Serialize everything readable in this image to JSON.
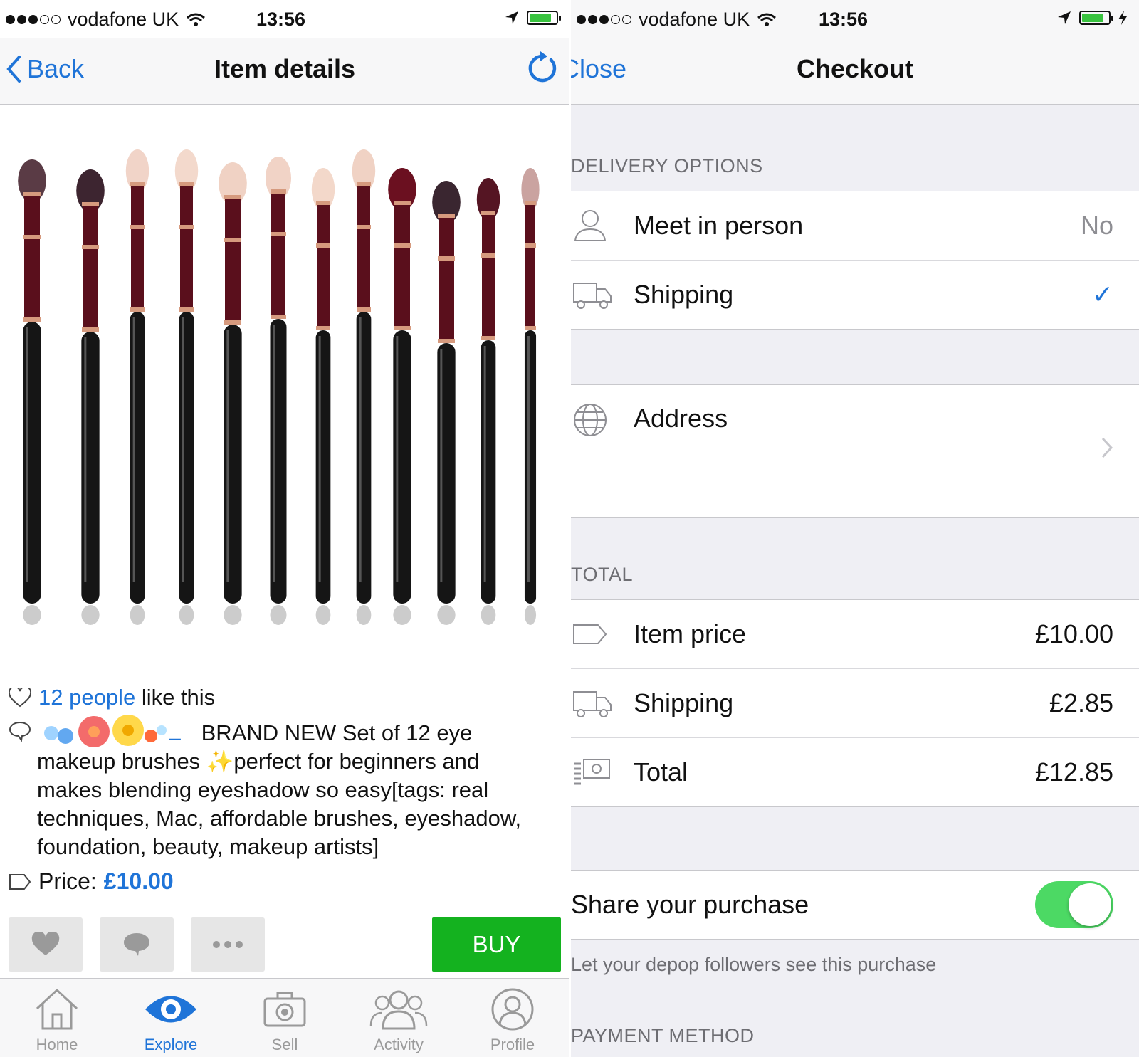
{
  "status": {
    "carrier": "vodafone UK",
    "time": "13:56"
  },
  "item_screen": {
    "nav": {
      "back_label": "Back",
      "title": "Item details"
    },
    "likes": {
      "count_label": "12 people",
      "suffix": "like this"
    },
    "description": {
      "username_suffix": "_",
      "text": "BRAND NEW Set of 12 eye makeup brushes ✨perfect for beginners and makes blending eyeshadow so easy[tags: real techniques, Mac, affordable brushes, eyeshadow, foundation, beauty, makeup artists]"
    },
    "price": {
      "label": "Price:",
      "value": "£10.00"
    },
    "buy_label": "BUY",
    "tabs": [
      {
        "label": "Home",
        "icon": "home-icon",
        "active": false
      },
      {
        "label": "Explore",
        "icon": "eye-icon",
        "active": true
      },
      {
        "label": "Sell",
        "icon": "camera-icon",
        "active": false
      },
      {
        "label": "Activity",
        "icon": "people-icon",
        "active": false
      },
      {
        "label": "Profile",
        "icon": "person-icon",
        "active": false
      }
    ]
  },
  "checkout_screen": {
    "nav": {
      "close_label": "Close",
      "title": "Checkout"
    },
    "delivery_header": "DELIVERY OPTIONS",
    "delivery": [
      {
        "label": "Meet in person",
        "value": "No",
        "icon": "person-icon"
      },
      {
        "label": "Shipping",
        "value": "✓",
        "icon": "truck-icon"
      }
    ],
    "address_label": "Address",
    "total_header": "TOTAL",
    "totals": [
      {
        "label": "Item price",
        "value": "£10.00",
        "icon": "tag-icon"
      },
      {
        "label": "Shipping",
        "value": "£2.85",
        "icon": "truck-icon"
      },
      {
        "label": "Total",
        "value": "£12.85",
        "icon": "money-icon"
      }
    ],
    "share": {
      "label": "Share your purchase",
      "on": true,
      "note": "Let your depop followers see this purchase"
    },
    "payment_header": "PAYMENT METHOD"
  },
  "colors": {
    "accent": "#1f74d8",
    "buy": "#14b21f",
    "toggle": "#4cd964"
  }
}
